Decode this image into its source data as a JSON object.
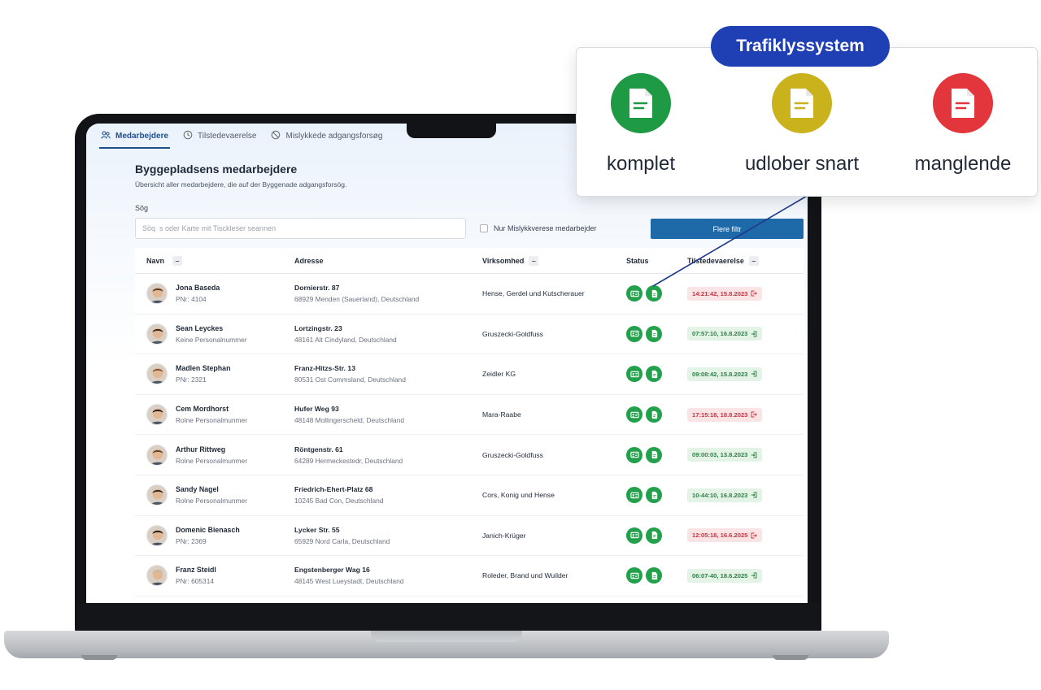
{
  "tabs": [
    {
      "label": "Medarbejdere",
      "icon": "people-icon",
      "active": true
    },
    {
      "label": "Tilstedevaerelse",
      "icon": "clock-icon",
      "active": false
    },
    {
      "label": "Mislykkede adgangsforsøg",
      "icon": "prohibited-icon",
      "active": false
    }
  ],
  "page": {
    "title": "Byggepladsens medarbejdere",
    "subtitle": "Übersicht aller medarbejdere, die auf der Byggenade adgangsforsög."
  },
  "search": {
    "label": "Sög",
    "placeholder": "Söq  s oder Karte mit Tisckleser seannen"
  },
  "filter": {
    "checkbox_label": "Nur Mislykkverese medarbejder",
    "more_filters_label": "Flere filtr"
  },
  "table": {
    "headers": {
      "name": "Navn",
      "address": "Adresse",
      "company": "Virksomhed",
      "status": "Status",
      "presence": "Tilstedevaerelse"
    },
    "rows": [
      {
        "name": "Jona Baseda",
        "sub": "PNr: 4104",
        "addr1": "Dornierstr. 87",
        "addr2": "68929 Menden (Sauerland), Deutschland",
        "company": "Hense, Gerdel und Kutscherauer",
        "time": "14:21:42, 15.8.2023",
        "time_status": "red"
      },
      {
        "name": "Sean Leyckes",
        "sub": "Keine Personalnummer",
        "addr1": "Lortzingstr. 23",
        "addr2": "48161 Alt Cindyland, Deutschland",
        "company": "Gruszecki-Goldfuss",
        "time": "07:57:10, 16.8.2023",
        "time_status": "green"
      },
      {
        "name": "Madlen Stephan",
        "sub": "PNr: 2321",
        "addr1": "Franz-Hitzs-Str. 13",
        "addr2": "80531 Ost Commsland, Deutschland",
        "company": "Zeidler KG",
        "time": "09:08:42, 15.8.2023",
        "time_status": "green"
      },
      {
        "name": "Cem Mordhorst",
        "sub": "Rolne Personalmunmer",
        "addr1": "Hufer Weg 93",
        "addr2": "48148 Mollingerscheld, Deutschland",
        "company": "Mara-Raabe",
        "time": "17:15:18, 18.8.2023",
        "time_status": "red"
      },
      {
        "name": "Arthur Rittweg",
        "sub": "Rolne Personalmunmer",
        "addr1": "Röntgenstr. 61",
        "addr2": "64289 Hermeckestedr, Deutschland",
        "company": "Gruszecki-Goldfuss",
        "time": "09:00:03, 13.8.2023",
        "time_status": "green"
      },
      {
        "name": "Sandy Nagel",
        "sub": "Rolne Personalmunmer",
        "addr1": "Friedrich-Ehert-Platz 68",
        "addr2": "10245 Bad Con, Deutschland",
        "company": "Cors, Konig und Hense",
        "time": "10-44:10, 16.8.2023",
        "time_status": "green"
      },
      {
        "name": "Domenic Bienasch",
        "sub": "PNr: 2369",
        "addr1": "Lycker Str. 55",
        "addr2": "65929 Nord Carla, Deutschland",
        "company": "Janich-Krüger",
        "time": "12:05:18, 16.6.2025",
        "time_status": "red"
      },
      {
        "name": "Franz Steidl",
        "sub": "PNr: 605314",
        "addr1": "Engstenberger Wag 16",
        "addr2": "48145 West Lueystadt, Deutschland",
        "company": "Roleder, Brand und Wuilder",
        "time": "06:07-40, 18.6.2025",
        "time_status": "green"
      }
    ]
  },
  "callout": {
    "title": "Trafiklyssystem",
    "items": [
      {
        "label": "komplet",
        "color": "#1e9a45"
      },
      {
        "label": "udlober snart",
        "color": "#c9b21c"
      },
      {
        "label": "manglende",
        "color": "#e2363c"
      }
    ]
  },
  "colors": {
    "accent": "#1f4e8c",
    "button": "#1e6aa8",
    "status_green": "#22a04b",
    "callout_title": "#1f3fb5"
  }
}
